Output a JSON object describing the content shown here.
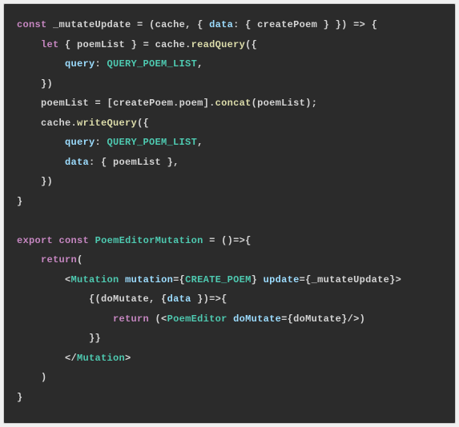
{
  "code": {
    "lines": [
      {
        "indent": 0,
        "segments": [
          {
            "cls": "kw",
            "t": "const"
          },
          {
            "cls": "pn",
            "t": " _mutateUpdate "
          },
          {
            "cls": "pn",
            "t": "="
          },
          {
            "cls": "pn",
            "t": " ("
          },
          {
            "cls": "id",
            "t": "cache"
          },
          {
            "cls": "pn",
            "t": ", { "
          },
          {
            "cls": "pr",
            "t": "data"
          },
          {
            "cls": "pn",
            "t": ": { "
          },
          {
            "cls": "id",
            "t": "createPoem"
          },
          {
            "cls": "pn",
            "t": " } }) "
          },
          {
            "cls": "pn",
            "t": "=>"
          },
          {
            "cls": "pn",
            "t": " {"
          }
        ]
      },
      {
        "indent": 1,
        "segments": [
          {
            "cls": "kw",
            "t": "let"
          },
          {
            "cls": "pn",
            "t": " { "
          },
          {
            "cls": "id",
            "t": "poemList"
          },
          {
            "cls": "pn",
            "t": " } "
          },
          {
            "cls": "pn",
            "t": "="
          },
          {
            "cls": "pn",
            "t": " "
          },
          {
            "cls": "id",
            "t": "cache"
          },
          {
            "cls": "pn",
            "t": "."
          },
          {
            "cls": "fn",
            "t": "readQuery"
          },
          {
            "cls": "pn",
            "t": "({"
          }
        ]
      },
      {
        "indent": 2,
        "segments": [
          {
            "cls": "pr",
            "t": "query"
          },
          {
            "cls": "pn",
            "t": ": "
          },
          {
            "cls": "cn",
            "t": "QUERY_POEM_LIST"
          },
          {
            "cls": "pn",
            "t": ","
          }
        ]
      },
      {
        "indent": 1,
        "segments": [
          {
            "cls": "pn",
            "t": "})"
          }
        ]
      },
      {
        "indent": 1,
        "segments": [
          {
            "cls": "id",
            "t": "poemList"
          },
          {
            "cls": "pn",
            "t": " "
          },
          {
            "cls": "pn",
            "t": "="
          },
          {
            "cls": "pn",
            "t": " ["
          },
          {
            "cls": "id",
            "t": "createPoem"
          },
          {
            "cls": "pn",
            "t": "."
          },
          {
            "cls": "id",
            "t": "poem"
          },
          {
            "cls": "pn",
            "t": "]."
          },
          {
            "cls": "fn",
            "t": "concat"
          },
          {
            "cls": "pn",
            "t": "("
          },
          {
            "cls": "id",
            "t": "poemList"
          },
          {
            "cls": "pn",
            "t": ");"
          }
        ]
      },
      {
        "indent": 1,
        "segments": [
          {
            "cls": "id",
            "t": "cache"
          },
          {
            "cls": "pn",
            "t": "."
          },
          {
            "cls": "fn",
            "t": "writeQuery"
          },
          {
            "cls": "pn",
            "t": "({"
          }
        ]
      },
      {
        "indent": 2,
        "segments": [
          {
            "cls": "pr",
            "t": "query"
          },
          {
            "cls": "pn",
            "t": ": "
          },
          {
            "cls": "cn",
            "t": "QUERY_POEM_LIST"
          },
          {
            "cls": "pn",
            "t": ","
          }
        ]
      },
      {
        "indent": 2,
        "segments": [
          {
            "cls": "pr",
            "t": "data"
          },
          {
            "cls": "pn",
            "t": ": { "
          },
          {
            "cls": "id",
            "t": "poemList"
          },
          {
            "cls": "pn",
            "t": " },"
          }
        ]
      },
      {
        "indent": 1,
        "segments": [
          {
            "cls": "pn",
            "t": "})"
          }
        ]
      },
      {
        "indent": 0,
        "segments": [
          {
            "cls": "pn",
            "t": "}"
          }
        ]
      },
      {
        "indent": 0,
        "segments": [
          {
            "cls": "pn",
            "t": " "
          }
        ]
      },
      {
        "indent": 0,
        "segments": [
          {
            "cls": "kw",
            "t": "export"
          },
          {
            "cls": "pn",
            "t": " "
          },
          {
            "cls": "kw",
            "t": "const"
          },
          {
            "cls": "pn",
            "t": " "
          },
          {
            "cls": "cn",
            "t": "PoemEditorMutation"
          },
          {
            "cls": "pn",
            "t": " "
          },
          {
            "cls": "pn",
            "t": "="
          },
          {
            "cls": "pn",
            "t": " ()"
          },
          {
            "cls": "pn",
            "t": "=>"
          },
          {
            "cls": "pn",
            "t": "{"
          }
        ]
      },
      {
        "indent": 1,
        "segments": [
          {
            "cls": "kw",
            "t": "return"
          },
          {
            "cls": "pn",
            "t": "("
          }
        ]
      },
      {
        "indent": 2,
        "segments": [
          {
            "cls": "pn",
            "t": "<"
          },
          {
            "cls": "cn",
            "t": "Mutation"
          },
          {
            "cls": "pn",
            "t": " "
          },
          {
            "cls": "pr",
            "t": "mutation"
          },
          {
            "cls": "pn",
            "t": "={"
          },
          {
            "cls": "cn",
            "t": "CREATE_POEM"
          },
          {
            "cls": "pn",
            "t": "} "
          },
          {
            "cls": "pr",
            "t": "update"
          },
          {
            "cls": "pn",
            "t": "={"
          },
          {
            "cls": "id",
            "t": "_mutateUpdate"
          },
          {
            "cls": "pn",
            "t": "}>"
          }
        ]
      },
      {
        "indent": 3,
        "segments": [
          {
            "cls": "pn",
            "t": "{("
          },
          {
            "cls": "id",
            "t": "doMutate"
          },
          {
            "cls": "pn",
            "t": ", {"
          },
          {
            "cls": "pr",
            "t": "data"
          },
          {
            "cls": "pn",
            "t": " })"
          },
          {
            "cls": "pn",
            "t": "=>"
          },
          {
            "cls": "pn",
            "t": "{"
          }
        ]
      },
      {
        "indent": 4,
        "segments": [
          {
            "cls": "kw",
            "t": "return"
          },
          {
            "cls": "pn",
            "t": " (<"
          },
          {
            "cls": "cn",
            "t": "PoemEditor"
          },
          {
            "cls": "pn",
            "t": " "
          },
          {
            "cls": "pr",
            "t": "doMutate"
          },
          {
            "cls": "pn",
            "t": "={"
          },
          {
            "cls": "id",
            "t": "doMutate"
          },
          {
            "cls": "pn",
            "t": "}/>)"
          }
        ]
      },
      {
        "indent": 3,
        "segments": [
          {
            "cls": "pn",
            "t": "}}"
          }
        ]
      },
      {
        "indent": 2,
        "segments": [
          {
            "cls": "pn",
            "t": "</"
          },
          {
            "cls": "cn",
            "t": "Mutation"
          },
          {
            "cls": "pn",
            "t": ">"
          }
        ]
      },
      {
        "indent": 1,
        "segments": [
          {
            "cls": "pn",
            "t": ")"
          }
        ]
      },
      {
        "indent": 0,
        "segments": [
          {
            "cls": "pn",
            "t": "}"
          }
        ]
      }
    ],
    "indentUnit": "    "
  }
}
